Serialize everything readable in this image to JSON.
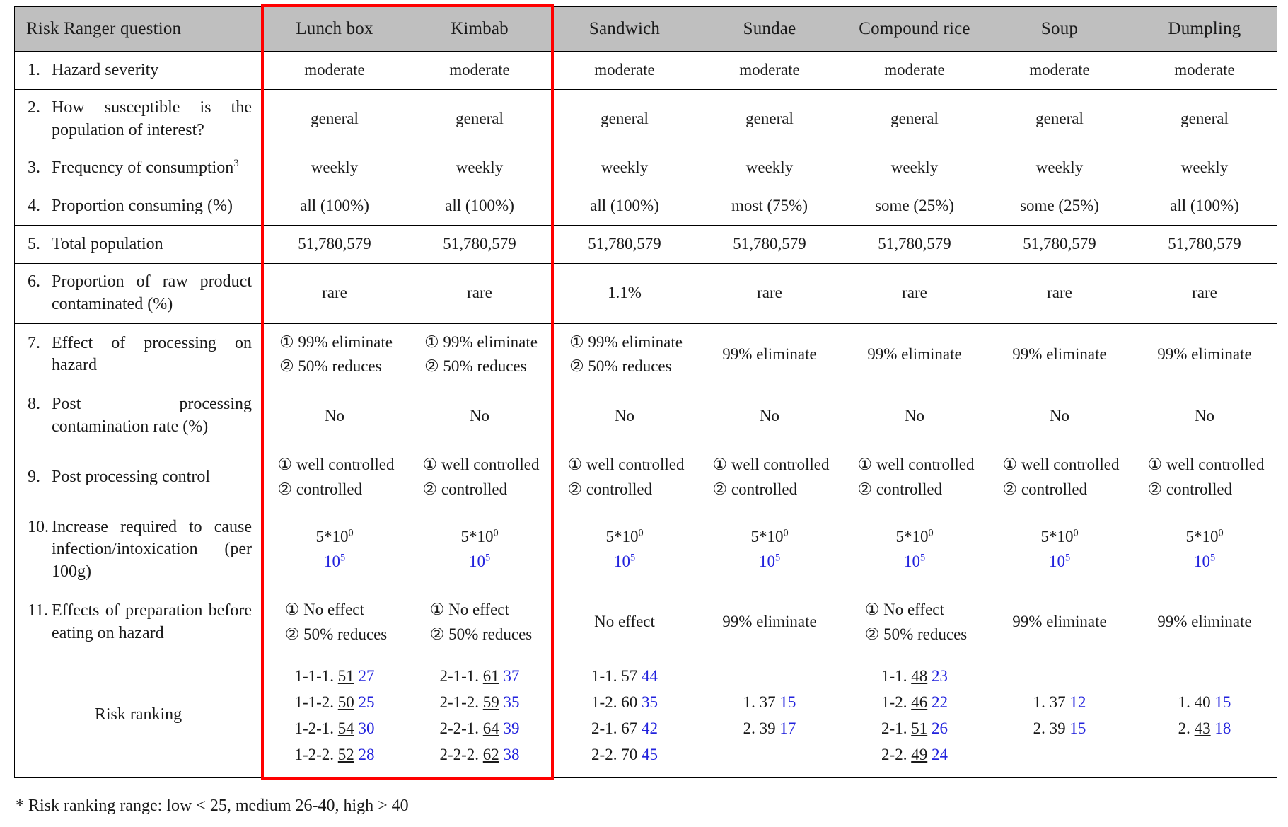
{
  "table": {
    "columns": [
      "Risk Ranger question",
      "Lunch box",
      "Kimbab",
      "Sandwich",
      "Sundae",
      "Compound rice",
      "Soup",
      "Dumpling"
    ],
    "highlight": {
      "columns": [
        "Lunch box",
        "Kimbab"
      ],
      "color": "#ff0000"
    },
    "rows": [
      {
        "num": "1.",
        "question": "Hazard severity",
        "values": [
          "moderate",
          "moderate",
          "moderate",
          "moderate",
          "moderate",
          "moderate",
          "moderate"
        ]
      },
      {
        "num": "2.",
        "question": "How susceptible is the population of interest?",
        "values": [
          "general",
          "general",
          "general",
          "general",
          "general",
          "general",
          "general"
        ]
      },
      {
        "num": "3.",
        "question": "Frequency of consumption",
        "question_sup": "3",
        "values": [
          "weekly",
          "weekly",
          "weekly",
          "weekly",
          "weekly",
          "weekly",
          "weekly"
        ]
      },
      {
        "num": "4.",
        "question": "Proportion consuming (%)",
        "values": [
          "all (100%)",
          "all (100%)",
          "all (100%)",
          "most (75%)",
          "some (25%)",
          "some (25%)",
          "all (100%)"
        ]
      },
      {
        "num": "5.",
        "question": "Total population",
        "values": [
          "51,780,579",
          "51,780,579",
          "51,780,579",
          "51,780,579",
          "51,780,579",
          "51,780,579",
          "51,780,579"
        ]
      },
      {
        "num": "6.",
        "question": "Proportion of raw product contaminated (%)",
        "values": [
          "rare",
          "rare",
          "1.1%",
          "rare",
          "rare",
          "rare",
          "rare"
        ]
      },
      {
        "num": "7.",
        "question": "Effect of processing on hazard",
        "values": [
          {
            "options": [
              "① 99% eliminate",
              "② 50% reduces"
            ]
          },
          {
            "options": [
              "① 99% eliminate",
              "② 50% reduces"
            ]
          },
          {
            "options": [
              "① 99% eliminate",
              "② 50% reduces"
            ]
          },
          "99% eliminate",
          "99% eliminate",
          "99% eliminate",
          "99% eliminate"
        ]
      },
      {
        "num": "8.",
        "question": "Post processing contamination rate (%)",
        "values": [
          "No",
          "No",
          "No",
          "No",
          "No",
          "No",
          "No"
        ]
      },
      {
        "num": "9.",
        "question": "Post processing control",
        "values": [
          {
            "options": [
              "① well controlled",
              "② controlled"
            ]
          },
          {
            "options": [
              "① well controlled",
              "② controlled"
            ]
          },
          {
            "options": [
              "① well controlled",
              "② controlled"
            ]
          },
          {
            "options": [
              "① well controlled",
              "② controlled"
            ]
          },
          {
            "options": [
              "① well controlled",
              "② controlled"
            ]
          },
          {
            "options": [
              "① well controlled",
              "② controlled"
            ]
          },
          {
            "options": [
              "① well controlled",
              "② controlled"
            ]
          }
        ]
      },
      {
        "num": "10.",
        "question": "Increase required to cause infection/intoxication (per 100g)",
        "values": [
          {
            "lines": [
              {
                "text": "5*10",
                "sup": "0",
                "color": "black"
              },
              {
                "text": "10",
                "sup": "5",
                "color": "blue"
              }
            ]
          },
          {
            "lines": [
              {
                "text": "5*10",
                "sup": "0",
                "color": "black"
              },
              {
                "text": "10",
                "sup": "5",
                "color": "blue"
              }
            ]
          },
          {
            "lines": [
              {
                "text": "5*10",
                "sup": "0",
                "color": "black"
              },
              {
                "text": "10",
                "sup": "5",
                "color": "blue"
              }
            ]
          },
          {
            "lines": [
              {
                "text": "5*10",
                "sup": "0",
                "color": "black"
              },
              {
                "text": "10",
                "sup": "5",
                "color": "blue"
              }
            ]
          },
          {
            "lines": [
              {
                "text": "5*10",
                "sup": "0",
                "color": "black"
              },
              {
                "text": "10",
                "sup": "5",
                "color": "blue"
              }
            ]
          },
          {
            "lines": [
              {
                "text": "5*10",
                "sup": "0",
                "color": "black"
              },
              {
                "text": "10",
                "sup": "5",
                "color": "blue"
              }
            ]
          },
          {
            "lines": [
              {
                "text": "5*10",
                "sup": "0",
                "color": "black"
              },
              {
                "text": "10",
                "sup": "5",
                "color": "blue"
              }
            ]
          }
        ]
      },
      {
        "num": "11.",
        "question": "Effects of preparation before eating on hazard",
        "values": [
          {
            "options": [
              "① No effect",
              "② 50% reduces"
            ]
          },
          {
            "options": [
              "① No effect",
              "② 50% reduces"
            ]
          },
          "No effect",
          "99% eliminate",
          {
            "options": [
              "① No effect",
              "② 50% reduces"
            ]
          },
          "99% eliminate",
          "99% eliminate"
        ]
      }
    ],
    "risk_ranking": {
      "label": "Risk ranking",
      "columns": [
        {
          "product": "Lunch box",
          "entries": [
            {
              "id": "1-1-1.",
              "black": "51",
              "black_underline": true,
              "blue": "27"
            },
            {
              "id": "1-1-2.",
              "black": "50",
              "black_underline": true,
              "blue": "25"
            },
            {
              "id": "1-2-1.",
              "black": "54",
              "black_underline": true,
              "blue": "30"
            },
            {
              "id": "1-2-2.",
              "black": "52",
              "black_underline": true,
              "blue": "28"
            }
          ]
        },
        {
          "product": "Kimbab",
          "entries": [
            {
              "id": "2-1-1.",
              "black": "61",
              "black_underline": true,
              "blue": "37"
            },
            {
              "id": "2-1-2.",
              "black": "59",
              "black_underline": true,
              "blue": "35"
            },
            {
              "id": "2-2-1.",
              "black": "64",
              "black_underline": true,
              "blue": "39"
            },
            {
              "id": "2-2-2.",
              "black": "62",
              "black_underline": true,
              "blue": "38"
            }
          ]
        },
        {
          "product": "Sandwich",
          "entries": [
            {
              "id": "1-1.",
              "black": "57",
              "black_underline": false,
              "blue": "44"
            },
            {
              "id": "1-2.",
              "black": "60",
              "black_underline": false,
              "blue": "35"
            },
            {
              "id": "2-1.",
              "black": "67",
              "black_underline": false,
              "blue": "42"
            },
            {
              "id": "2-2.",
              "black": "70",
              "black_underline": false,
              "blue": "45"
            }
          ]
        },
        {
          "product": "Sundae",
          "entries": [
            {
              "id": "1.",
              "black": "37",
              "black_underline": false,
              "blue": "15"
            },
            {
              "id": "2.",
              "black": "39",
              "black_underline": false,
              "blue": "17"
            }
          ]
        },
        {
          "product": "Compound rice",
          "entries": [
            {
              "id": "1-1.",
              "black": "48",
              "black_underline": true,
              "blue": "23"
            },
            {
              "id": "1-2.",
              "black": "46",
              "black_underline": true,
              "blue": "22"
            },
            {
              "id": "2-1.",
              "black": "51",
              "black_underline": true,
              "blue": "26"
            },
            {
              "id": "2-2.",
              "black": "49",
              "black_underline": true,
              "blue": "24"
            }
          ]
        },
        {
          "product": "Soup",
          "entries": [
            {
              "id": "1.",
              "black": "37",
              "black_underline": false,
              "blue": "12"
            },
            {
              "id": "2.",
              "black": "39",
              "black_underline": false,
              "blue": "15"
            }
          ]
        },
        {
          "product": "Dumpling",
          "entries": [
            {
              "id": "1.",
              "black": "40",
              "black_underline": false,
              "blue": "15"
            },
            {
              "id": "2.",
              "black": "43",
              "black_underline": true,
              "blue": "18"
            }
          ]
        }
      ]
    }
  },
  "footnote": "* Risk ranking range: low < 25, medium 26-40, high > 40"
}
